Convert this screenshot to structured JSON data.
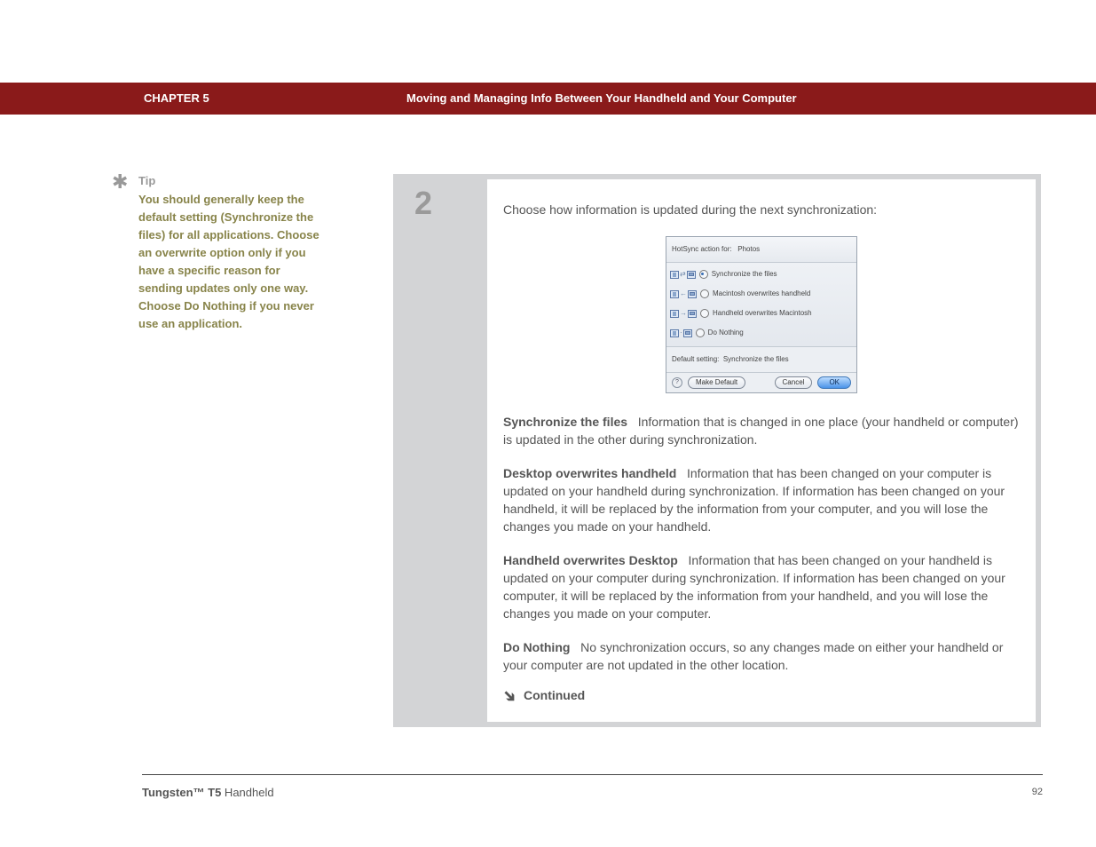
{
  "header": {
    "chapter": "CHAPTER 5",
    "title": "Moving and Managing Info Between Your Handheld and Your Computer"
  },
  "tip": {
    "heading": "Tip",
    "body": "You should generally keep the default setting (Synchronize the files) for all applications. Choose an overwrite option only if you have a specific reason for sending updates only one way. Choose Do Nothing if you never use an application."
  },
  "step": {
    "number": "2",
    "intro": "Choose how information is updated during the next synchronization:",
    "options": [
      {
        "term": "Synchronize the files",
        "desc": "Information that is changed in one place (your handheld or computer) is updated in the other during synchronization."
      },
      {
        "term": "Desktop overwrites handheld",
        "desc": "Information that has been changed on your computer is updated on your handheld during synchronization. If information has been changed on your handheld, it will be replaced by the information from your computer, and you will lose the changes you made on your handheld."
      },
      {
        "term": "Handheld overwrites Desktop",
        "desc": "Information that has been changed on your handheld is updated on your computer during synchronization. If information has been changed on your computer, it will be replaced by the information from your handheld, and you will lose the changes you made on your computer."
      },
      {
        "term": "Do Nothing",
        "desc": "No synchronization occurs, so any changes made on either your handheld or your computer are not updated in the other location."
      }
    ],
    "continued": "Continued"
  },
  "dialog": {
    "title_prefix": "HotSync action for:",
    "title_value": "Photos",
    "rows": [
      {
        "label": "Synchronize the files",
        "selected": true
      },
      {
        "label": "Macintosh overwrites handheld",
        "selected": false
      },
      {
        "label": "Handheld overwrites Macintosh",
        "selected": false
      },
      {
        "label": "Do Nothing",
        "selected": false
      }
    ],
    "default_line_prefix": "Default setting:",
    "default_line_value": "Synchronize the files",
    "buttons": {
      "make_default": "Make Default",
      "cancel": "Cancel",
      "ok": "OK"
    }
  },
  "footer": {
    "product_bold": "Tungsten™ T5",
    "product_rest": " Handheld",
    "page": "92"
  }
}
